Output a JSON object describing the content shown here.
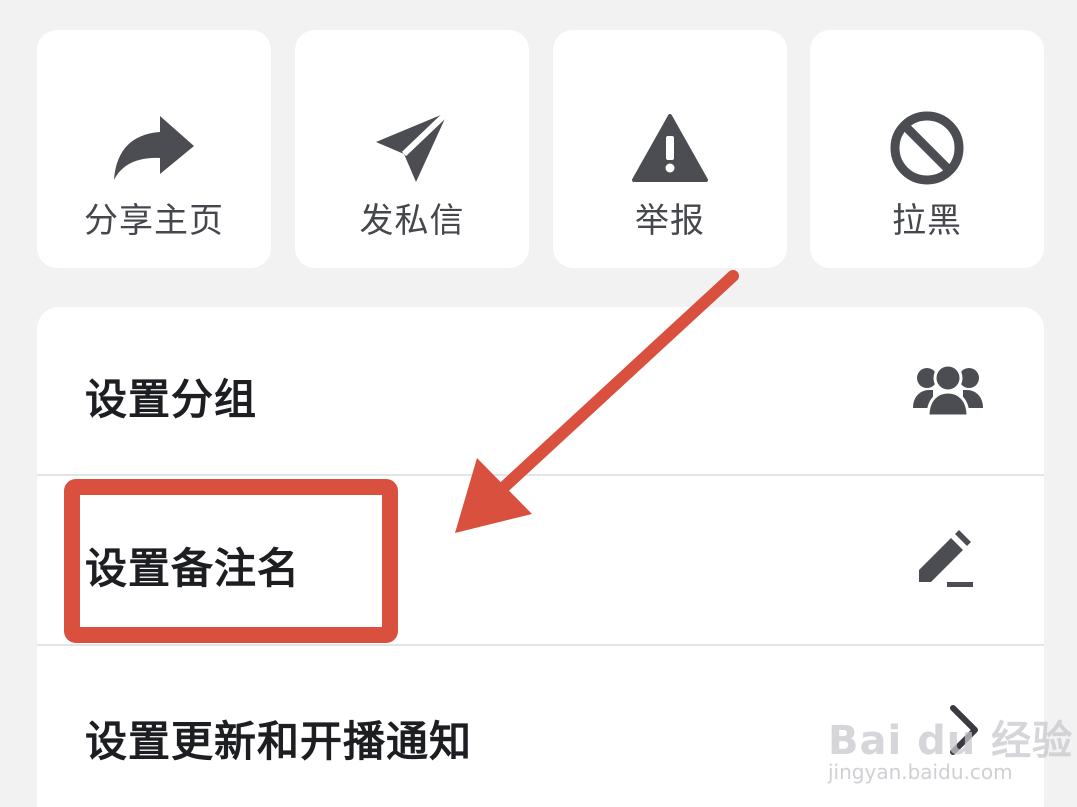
{
  "actions": [
    {
      "label": "分享主页",
      "icon": "share-icon"
    },
    {
      "label": "发私信",
      "icon": "send-icon"
    },
    {
      "label": "举报",
      "icon": "warning-icon"
    },
    {
      "label": "拉黑",
      "icon": "block-icon"
    }
  ],
  "settings": {
    "items": [
      {
        "label": "设置分组",
        "icon": "group-icon"
      },
      {
        "label": "设置备注名",
        "icon": "edit-icon"
      },
      {
        "label": "设置更新和开播通知",
        "icon": "chevron-right-icon"
      }
    ]
  },
  "watermark": {
    "main": "Bai du 经验",
    "sub": "jingyan.baidu.com"
  },
  "colors": {
    "background": "#f2f2f2",
    "card": "#ffffff",
    "icon": "#4b4d52",
    "annotation": "#d9503f"
  }
}
